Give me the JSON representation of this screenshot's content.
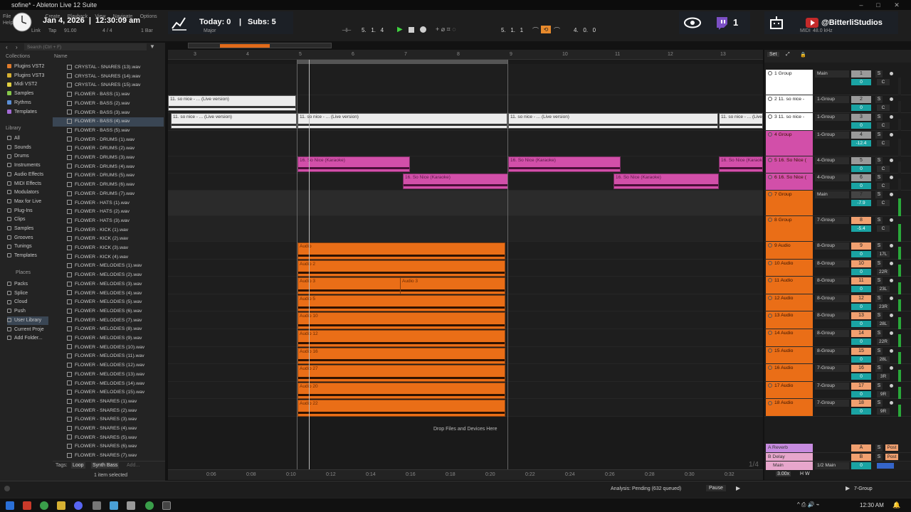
{
  "window": {
    "title": "sofine* - Ableton Live 12 Suite"
  },
  "menu": [
    "File",
    "Create",
    "Playback",
    "View",
    "Navigate",
    "Options",
    "Help"
  ],
  "overlay": {
    "date_time": "Jan 4, 2026  |  12:30:09 am",
    "today": "Today: 0",
    "subs": "Subs: 5",
    "viewers": "1",
    "channel": "@BitterliStudios"
  },
  "transport": {
    "link": "Link",
    "tap": "Tap",
    "tempo": "91.00",
    "time_sig": "4 / 4",
    "quantize": "1 Bar",
    "scale": "Major",
    "position": "5.   1.   4",
    "loop_start": "5.   1.   1",
    "loop_length": "4.   0.   0",
    "midi_label": "MIDI",
    "sample_rate": "48.0 kHz"
  },
  "browser": {
    "search_placeholder": "Search (Ctrl + F)",
    "collections_header": "Collections",
    "collections": [
      {
        "label": "Plugins VST2",
        "color": "#e07b2c"
      },
      {
        "label": "Plugins VST3",
        "color": "#d6b032"
      },
      {
        "label": "Midi VST2",
        "color": "#e2d041"
      },
      {
        "label": "Samples",
        "color": "#86c84a"
      },
      {
        "label": "Rythms",
        "color": "#5b8fd6"
      },
      {
        "label": "Templates",
        "color": "#a46ad6"
      }
    ],
    "library_header": "Library",
    "library": [
      "All",
      "Sounds",
      "Drums",
      "Instruments",
      "Audio Effects",
      "MIDI Effects",
      "Modulators",
      "Max for Live",
      "Plug-Ins",
      "Clips",
      "Samples",
      "Grooves",
      "Tunings",
      "Templates"
    ],
    "places_header": "Places",
    "places": [
      "Packs",
      "Splice",
      "Cloud",
      "Push",
      "User Library",
      "Current Proje",
      "Add Folder..."
    ],
    "name_header": "Name",
    "files": [
      "CRYSTAL - SNARES (13).wav",
      "CRYSTAL - SNARES (14).wav",
      "CRYSTAL - SNARES (15).wav",
      "FLOWER - BASS (1).wav",
      "FLOWER - BASS (2).wav",
      "FLOWER - BASS (3).wav",
      "FLOWER - BASS (4).wav",
      "FLOWER - BASS (5).wav",
      "FLOWER - DRUMS (1).wav",
      "FLOWER - DRUMS (2).wav",
      "FLOWER - DRUMS (3).wav",
      "FLOWER - DRUMS (4).wav",
      "FLOWER - DRUMS (5).wav",
      "FLOWER - DRUMS (6).wav",
      "FLOWER - DRUMS (7).wav",
      "FLOWER - HATS (1).wav",
      "FLOWER - HATS (2).wav",
      "FLOWER - HATS (3).wav",
      "FLOWER - KICK (1).wav",
      "FLOWER - KICK (2).wav",
      "FLOWER - KICK (3).wav",
      "FLOWER - KICK (4).wav",
      "FLOWER - MELODIES (1).wav",
      "FLOWER - MELODIES (2).wav",
      "FLOWER - MELODIES (3).wav",
      "FLOWER - MELODIES (4).wav",
      "FLOWER - MELODIES (5).wav",
      "FLOWER - MELODIES (6).wav",
      "FLOWER - MELODIES (7).wav",
      "FLOWER - MELODIES (8).wav",
      "FLOWER - MELODIES (9).wav",
      "FLOWER - MELODIES (10).wav",
      "FLOWER - MELODIES (11).wav",
      "FLOWER - MELODIES (12).wav",
      "FLOWER - MELODIES (13).wav",
      "FLOWER - MELODIES (14).wav",
      "FLOWER - MELODIES (15).wav",
      "FLOWER - SNARES (1).wav",
      "FLOWER - SNARES (2).wav",
      "FLOWER - SNARES (3).wav",
      "FLOWER - SNARES (4).wav",
      "FLOWER - SNARES (5).wav",
      "FLOWER - SNARES (6).wav",
      "FLOWER - SNARES (7).wav"
    ],
    "selected_file": "FLOWER - BASS (4).wav",
    "tags_label": "Tags:",
    "tags": [
      "Loop",
      "Synth Bass"
    ],
    "tags_add": "Add...",
    "selected_count": "1 item selected"
  },
  "arrangement": {
    "bar_ticks": [
      "3",
      "4",
      "5",
      "6",
      "7",
      "8",
      "9",
      "10",
      "11",
      "12",
      "13"
    ],
    "time_ticks": [
      "0:06",
      "0:08",
      "0:10",
      "0:12",
      "0:14",
      "0:16",
      "0:18",
      "0:20",
      "0:22",
      "0:24",
      "0:26",
      "0:28",
      "0:30",
      "0:32"
    ],
    "drop_hint": "Drop Files and Devices Here",
    "zoom_label": "1/4",
    "clip_names": {
      "live": "11. so nice - ... (Live version)",
      "karaoke": "16. So Nice (Karaoke)",
      "karaoke_short": "16. So N",
      "audio": [
        "Audio",
        "Audio 2",
        "Audio 3",
        "Audio 5",
        "Audio 10",
        "Audio 12",
        "Audio 16",
        "Audio 27",
        "Audio 20",
        "Audio 22"
      ],
      "audio3b": "Audio 3"
    }
  },
  "mixer": {
    "set_label": "Set",
    "tracks": [
      {
        "name": "1 Group",
        "route": "Main",
        "num": "1",
        "vol": "0",
        "pan": "C",
        "color": "#ffffff",
        "num_color": "#9a9a9a"
      },
      {
        "name": "2 11. so nice -",
        "route": "1-Group",
        "num": "2",
        "vol": "0",
        "pan": "C",
        "color": "#ffffff",
        "num_color": "#9a9a9a"
      },
      {
        "name": "3 11. so nice -",
        "route": "1-Group",
        "num": "3",
        "vol": "0",
        "pan": "C",
        "color": "#ffffff",
        "num_color": "#9a9a9a"
      },
      {
        "name": "4 Group",
        "route": "1-Group",
        "num": "4",
        "vol": "-12.4",
        "pan": "C",
        "color": "#d24fa9",
        "num_color": "#9a9a9a"
      },
      {
        "name": "5 16. So Nice (",
        "route": "4-Group",
        "num": "5",
        "vol": "0",
        "pan": "C",
        "color": "#d24fa9",
        "num_color": "#9a9a9a"
      },
      {
        "name": "6 16. So Nice (",
        "route": "4-Group",
        "num": "6",
        "vol": "0",
        "pan": "C",
        "color": "#d24fa9",
        "num_color": "#9a9a9a"
      },
      {
        "name": "7 Group",
        "route": "Main",
        "num": "7",
        "vol": "-7.9",
        "pan": "C",
        "color": "#ea6e17",
        "num_color": "#444"
      },
      {
        "name": "8 Group",
        "route": "7-Group",
        "num": "8",
        "vol": "-5.4",
        "pan": "C",
        "color": "#ea6e17",
        "num_color": "#f0a070"
      },
      {
        "name": "9 Audio",
        "route": "8-Group",
        "num": "9",
        "vol": "0",
        "pan": "17L",
        "color": "#ea6e17",
        "num_color": "#f0a070"
      },
      {
        "name": "10 Audio",
        "route": "8-Group",
        "num": "10",
        "vol": "0",
        "pan": "22R",
        "color": "#ea6e17",
        "num_color": "#f0a070"
      },
      {
        "name": "11 Audio",
        "route": "8-Group",
        "num": "11",
        "vol": "0",
        "pan": "23L",
        "color": "#ea6e17",
        "num_color": "#f0a070"
      },
      {
        "name": "12 Audio",
        "route": "8-Group",
        "num": "12",
        "vol": "0",
        "pan": "23R",
        "color": "#ea6e17",
        "num_color": "#f0a070"
      },
      {
        "name": "13 Audio",
        "route": "8-Group",
        "num": "13",
        "vol": "0",
        "pan": "28L",
        "color": "#ea6e17",
        "num_color": "#f0a070"
      },
      {
        "name": "14 Audio",
        "route": "8-Group",
        "num": "14",
        "vol": "0",
        "pan": "22R",
        "color": "#ea6e17",
        "num_color": "#f0a070"
      },
      {
        "name": "15 Audio",
        "route": "8-Group",
        "num": "15",
        "vol": "0",
        "pan": "28L",
        "color": "#ea6e17",
        "num_color": "#f0a070"
      },
      {
        "name": "16 Audio",
        "route": "7-Group",
        "num": "16",
        "vol": "0",
        "pan": "3R",
        "color": "#ea6e17",
        "num_color": "#f0a070"
      },
      {
        "name": "17 Audio",
        "route": "7-Group",
        "num": "17",
        "vol": "0",
        "pan": "9R",
        "color": "#ea6e17",
        "num_color": "#f0a070"
      },
      {
        "name": "18 Audio",
        "route": "7-Group",
        "num": "18",
        "vol": "0",
        "pan": "9R",
        "color": "#ea6e17",
        "num_color": "#f0a070"
      }
    ],
    "returns": [
      {
        "name": "A Reverb",
        "num": "A",
        "post": "Post"
      },
      {
        "name": "B Delay",
        "num": "B",
        "post": "Post"
      }
    ],
    "main": {
      "name": "Main",
      "route": "1/2 Main",
      "vol": "0",
      "zoom": "3.00x"
    }
  },
  "status": {
    "analysis": "Analysis: Pending (632 queued)",
    "pause": "Pause",
    "selected_track": "7-Group"
  },
  "taskbar": {
    "time": "12:30 AM"
  }
}
